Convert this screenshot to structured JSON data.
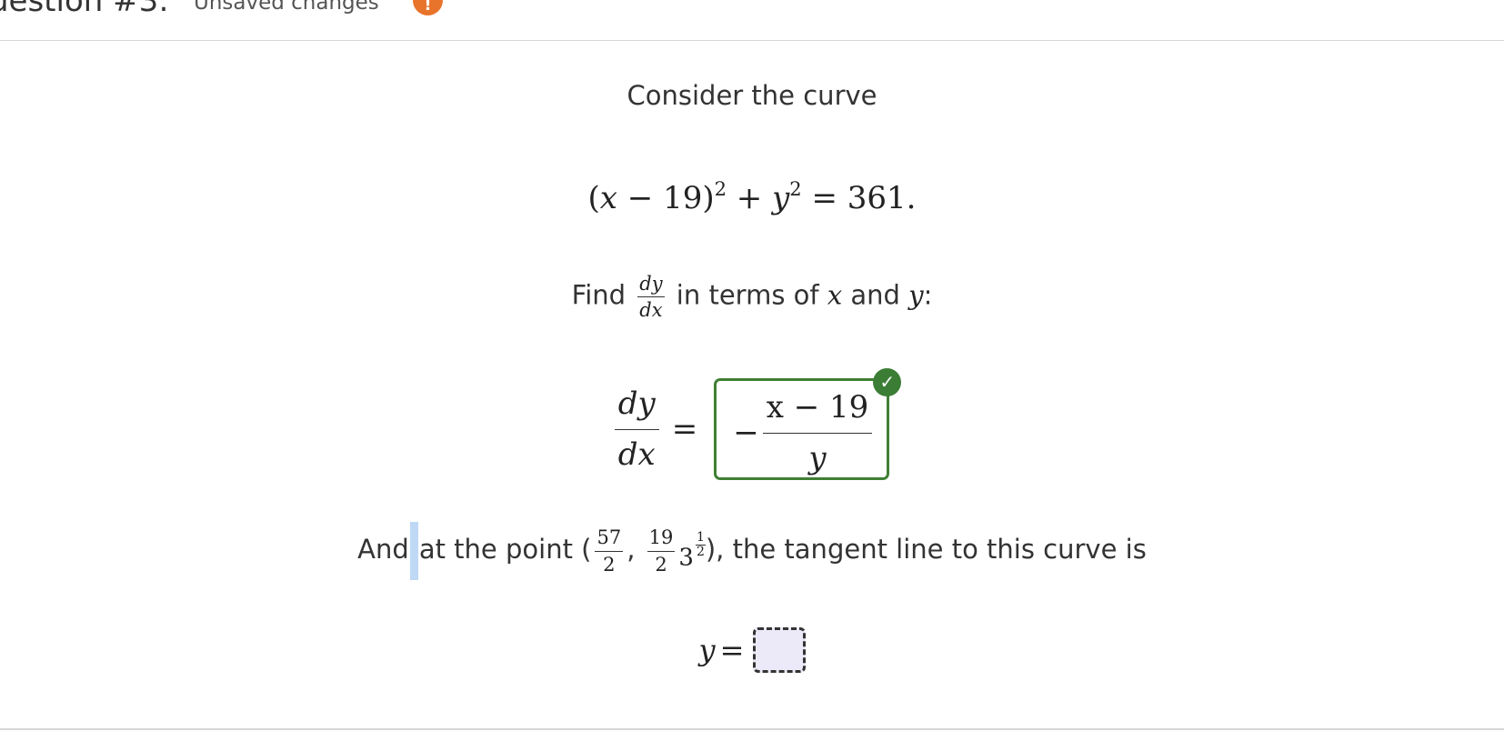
{
  "header": {
    "question_title": "uestion #3:",
    "status_text": "Unsaved changes",
    "warning_icon": "alert-icon",
    "warning_glyph": "!",
    "warning_color": "#e8742c"
  },
  "problem": {
    "intro_text": "Consider the curve",
    "equation": {
      "open": "(",
      "x": "x",
      "minus": " − ",
      "h": "19",
      "close": ")",
      "exp1": "2",
      "plus": " + ",
      "y": "y",
      "exp2": "2",
      "equals": " = ",
      "rhs": "361."
    },
    "find_prefix": "Find",
    "find_frac_num": "dy",
    "find_frac_den": "dx",
    "find_middle": "in terms of",
    "find_var_x": "x",
    "find_and": "and",
    "find_var_y": "y",
    "find_suffix": ":"
  },
  "derivative_answer": {
    "lhs_num": "dy",
    "lhs_den": "dx",
    "equals": "=",
    "sign": "−",
    "num": "x − 19",
    "den": "y",
    "status_icon": "check-icon",
    "status_glyph": "✓",
    "status_color": "#3b7d35",
    "border_color": "#3f7f34"
  },
  "tangent_prompt": {
    "word_and": "And",
    "text_before_point": "at the point (",
    "px_num": "57",
    "px_den": "2",
    "separator": ",",
    "py_num": "19",
    "py_den": "2",
    "py_base": "3",
    "py_exp_num": "1",
    "py_exp_den": "2",
    "text_after_point": "), the tangent line to this curve is"
  },
  "tangent_answer": {
    "var": "y",
    "equals": "=",
    "value": ""
  }
}
